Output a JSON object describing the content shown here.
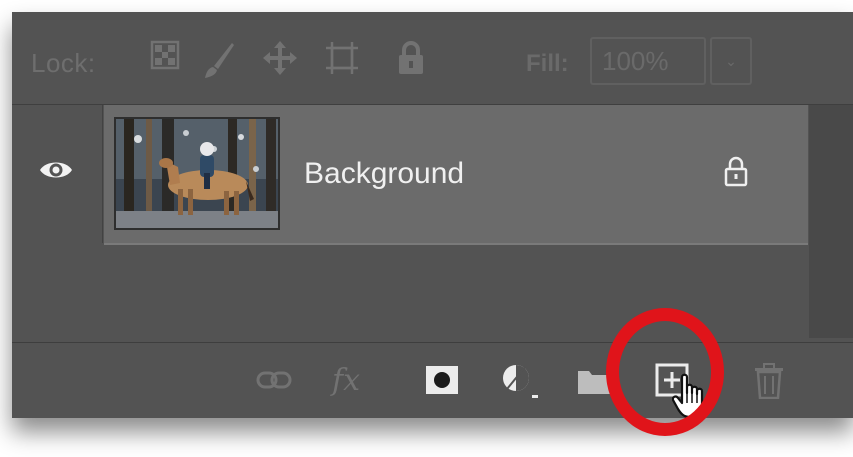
{
  "lock_bar": {
    "label": "Lock:",
    "icons": [
      "lock-transparent-pixels-icon",
      "lock-image-pixels-icon",
      "lock-position-icon",
      "lock-artboard-icon",
      "lock-all-icon"
    ],
    "fill_label": "Fill:",
    "fill_value": "100%",
    "fill_dropdown_icon": "chevron-down-icon"
  },
  "layers": [
    {
      "name": "Background",
      "visibility_icon": "eye-icon",
      "locked_icon": "padlock-icon",
      "thumbnail": "horse-rider-snowy-forest-thumbnail"
    }
  ],
  "footer": {
    "icons": [
      "link-layers-icon",
      "fx-icon",
      "add-mask-icon",
      "adjustment-layer-icon",
      "new-group-icon",
      "new-layer-icon",
      "delete-layer-icon"
    ],
    "fx_text": "fx",
    "cursor": "hand-pointer-cursor",
    "highlight_color": "#e0141a"
  },
  "colors": {
    "panel_bg": "#535353",
    "selected_layer_bg": "#6b6b6b",
    "text": "#f0f0f0",
    "dim_icon": "#727272"
  }
}
